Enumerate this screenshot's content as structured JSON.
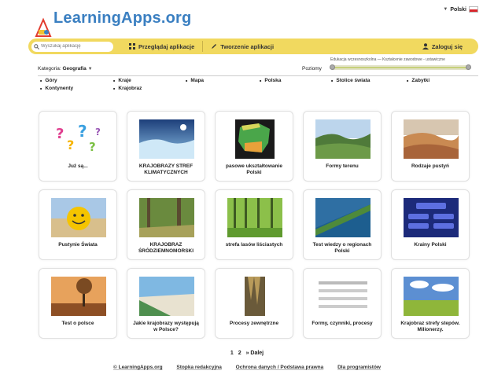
{
  "header": {
    "logo_text": "LearningApps.org",
    "language": "Polski"
  },
  "toolbar": {
    "search_placeholder": "Wyszukaj aplikację",
    "browse_label": "Przeglądaj aplikacje",
    "create_label": "Tworzenie aplikacji",
    "login_label": "Zaloguj się"
  },
  "filters": {
    "category_label": "Kategoria:",
    "category_value": "Geografia",
    "levels_label": "Poziomy",
    "levels_range_text": "Edukacja wczesnoszkolna — Kształcenie zawodowe - ustawiczne",
    "tags": [
      "Góry",
      "Kraje",
      "Mapa",
      "Polska",
      "Stolice świata",
      "Zabytki",
      "Kontynenty",
      "Krajobraz"
    ]
  },
  "apps": [
    {
      "title": "Już są..."
    },
    {
      "title": "KRAJOBRAZY STREF KLIMATYCZNYCH"
    },
    {
      "title": "pasowe ukształtowanie Polski"
    },
    {
      "title": "Formy terenu"
    },
    {
      "title": "Rodzaje pustyń"
    },
    {
      "title": "Pustynie Świata"
    },
    {
      "title": "KRAJOBRAZ ŚRÓDZIEMNOMORSKI"
    },
    {
      "title": "strefa lasów liściastych"
    },
    {
      "title": "Test wiedzy o regionach Polski"
    },
    {
      "title": "Krainy Polski"
    },
    {
      "title": "Test o polsce"
    },
    {
      "title": "Jakie krajobrazy występują w Polsce?"
    },
    {
      "title": "Procesy zewnętrzne"
    },
    {
      "title": "Formy, czynniki, procesy"
    },
    {
      "title": "Krajobraz strefy stepów. Milionerzy."
    }
  ],
  "pagination": {
    "page1": "1",
    "page2": "2",
    "next": "» Dalej"
  },
  "footer": {
    "links": [
      "© LearningApps.org",
      "Stopka redakcyjna",
      "Ochrona danych / Podstawa prawna",
      "Dla programistów"
    ]
  },
  "colors": {
    "toolbar": "#f1d95f",
    "logo": "#3a7fc1"
  }
}
